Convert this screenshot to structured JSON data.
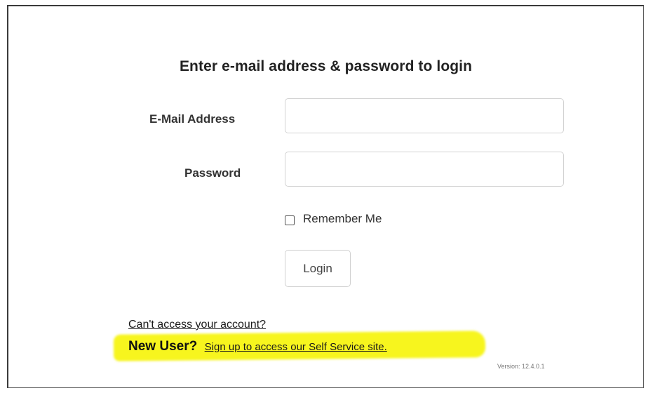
{
  "login": {
    "title": "Enter e-mail address & password to login",
    "email_label": "E-Mail Address",
    "email_value": "",
    "password_label": "Password",
    "password_value": "",
    "remember_label": "Remember Me",
    "remember_checked": false,
    "login_button": "Login"
  },
  "links": {
    "cant_access": "Can't access your account?",
    "new_user": "New User?",
    "signup": "Sign up to access our Self Service site."
  },
  "footer": {
    "version": "Version: 12.4.0.1"
  },
  "colors": {
    "highlight": "#f7f51e",
    "frame_border": "#3a3a3a",
    "field_border": "#d2d2d2"
  }
}
